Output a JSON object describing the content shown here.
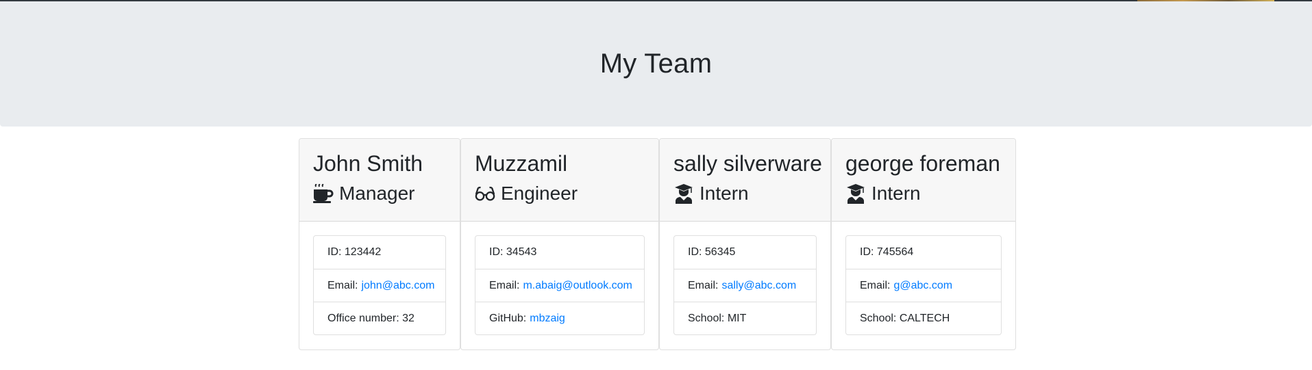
{
  "header": {
    "title": "My Team"
  },
  "team": [
    {
      "name": "John Smith",
      "role": "Manager",
      "icon": "coffee-icon",
      "rows": [
        {
          "label": "ID: 123442",
          "link": ""
        },
        {
          "label": "Email:",
          "link": "john@abc.com"
        },
        {
          "label": "Office number: 32",
          "link": ""
        }
      ]
    },
    {
      "name": "Muzzamil",
      "role": "Engineer",
      "icon": "glasses-icon",
      "rows": [
        {
          "label": "ID: 34543",
          "link": ""
        },
        {
          "label": "Email:",
          "link": "m.abaig@outlook.com"
        },
        {
          "label": "GitHub:",
          "link": "mbzaig"
        }
      ]
    },
    {
      "name": "sally silverware",
      "role": "Intern",
      "icon": "graduate-icon",
      "rows": [
        {
          "label": "ID: 56345",
          "link": ""
        },
        {
          "label": "Email:",
          "link": "sally@abc.com"
        },
        {
          "label": "School: MIT",
          "link": ""
        }
      ]
    },
    {
      "name": "george foreman",
      "role": "Intern",
      "icon": "graduate-icon",
      "rows": [
        {
          "label": "ID: 745564",
          "link": ""
        },
        {
          "label": "Email:",
          "link": "g@abc.com"
        },
        {
          "label": "School: CALTECH",
          "link": ""
        }
      ]
    }
  ],
  "colors": {
    "jumbotron_bg": "#e9ecef",
    "link": "#007bff",
    "card_header_bg": "#f7f7f7"
  }
}
